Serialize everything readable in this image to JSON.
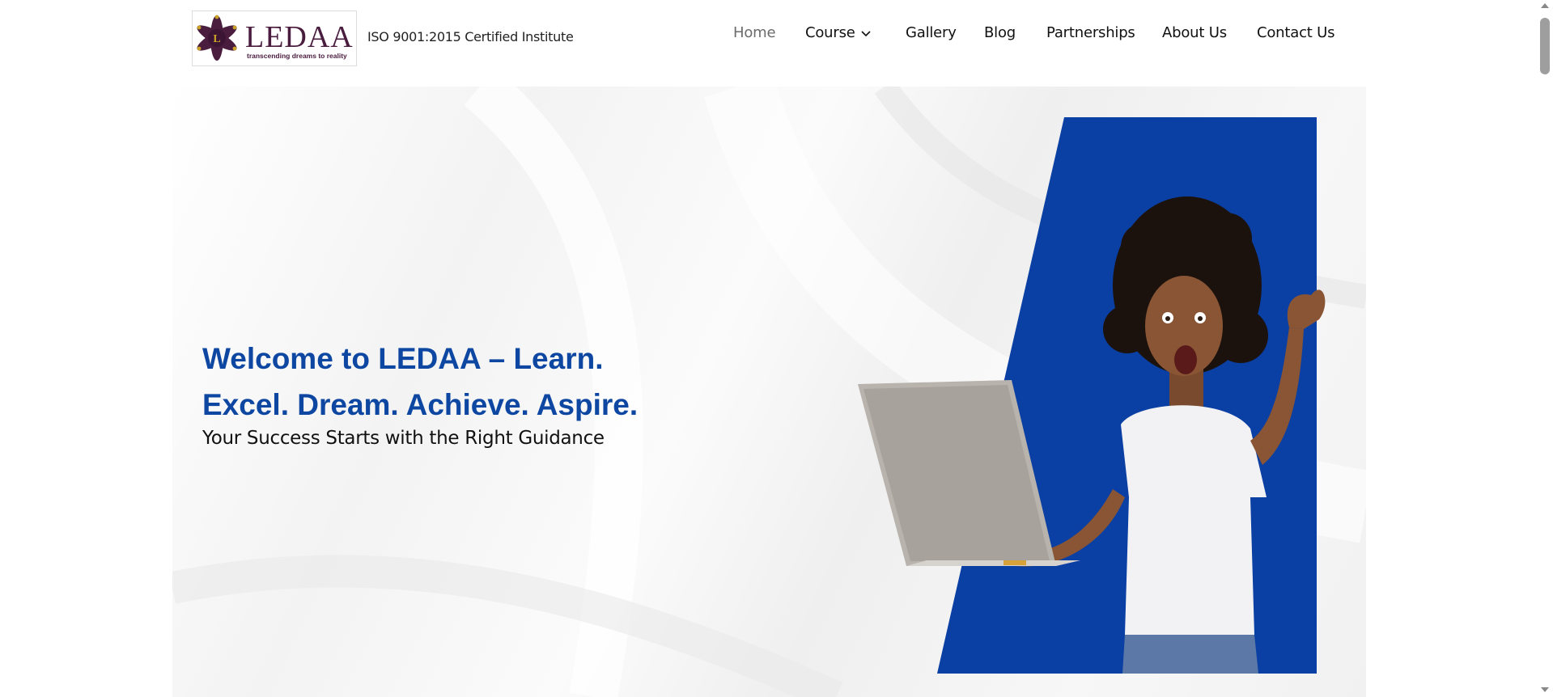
{
  "brand": {
    "name": "LEDAA",
    "tagline": "transcending dreams to reality",
    "emblem_letter": "L",
    "certification": "ISO 9001:2015 Certified Institute",
    "colors": {
      "logo_purple": "#4a1d3f",
      "logo_gold": "#c9a227"
    }
  },
  "nav": {
    "items": [
      {
        "label": "Home",
        "active": true
      },
      {
        "label": "Course",
        "has_dropdown": true
      },
      {
        "label": "Gallery"
      },
      {
        "label": "Blog"
      },
      {
        "label": "Partnerships"
      },
      {
        "label": "About Us"
      },
      {
        "label": "Contact Us"
      }
    ]
  },
  "hero": {
    "title_line1": "Welcome to LEDAA – Learn.",
    "title_line2": "Excel. Dream. Achieve. Aspire.",
    "subtitle": "Your Success Starts with the Right Guidance",
    "colors": {
      "title": "#0d47a1",
      "panel": "#0a3fa3"
    }
  }
}
